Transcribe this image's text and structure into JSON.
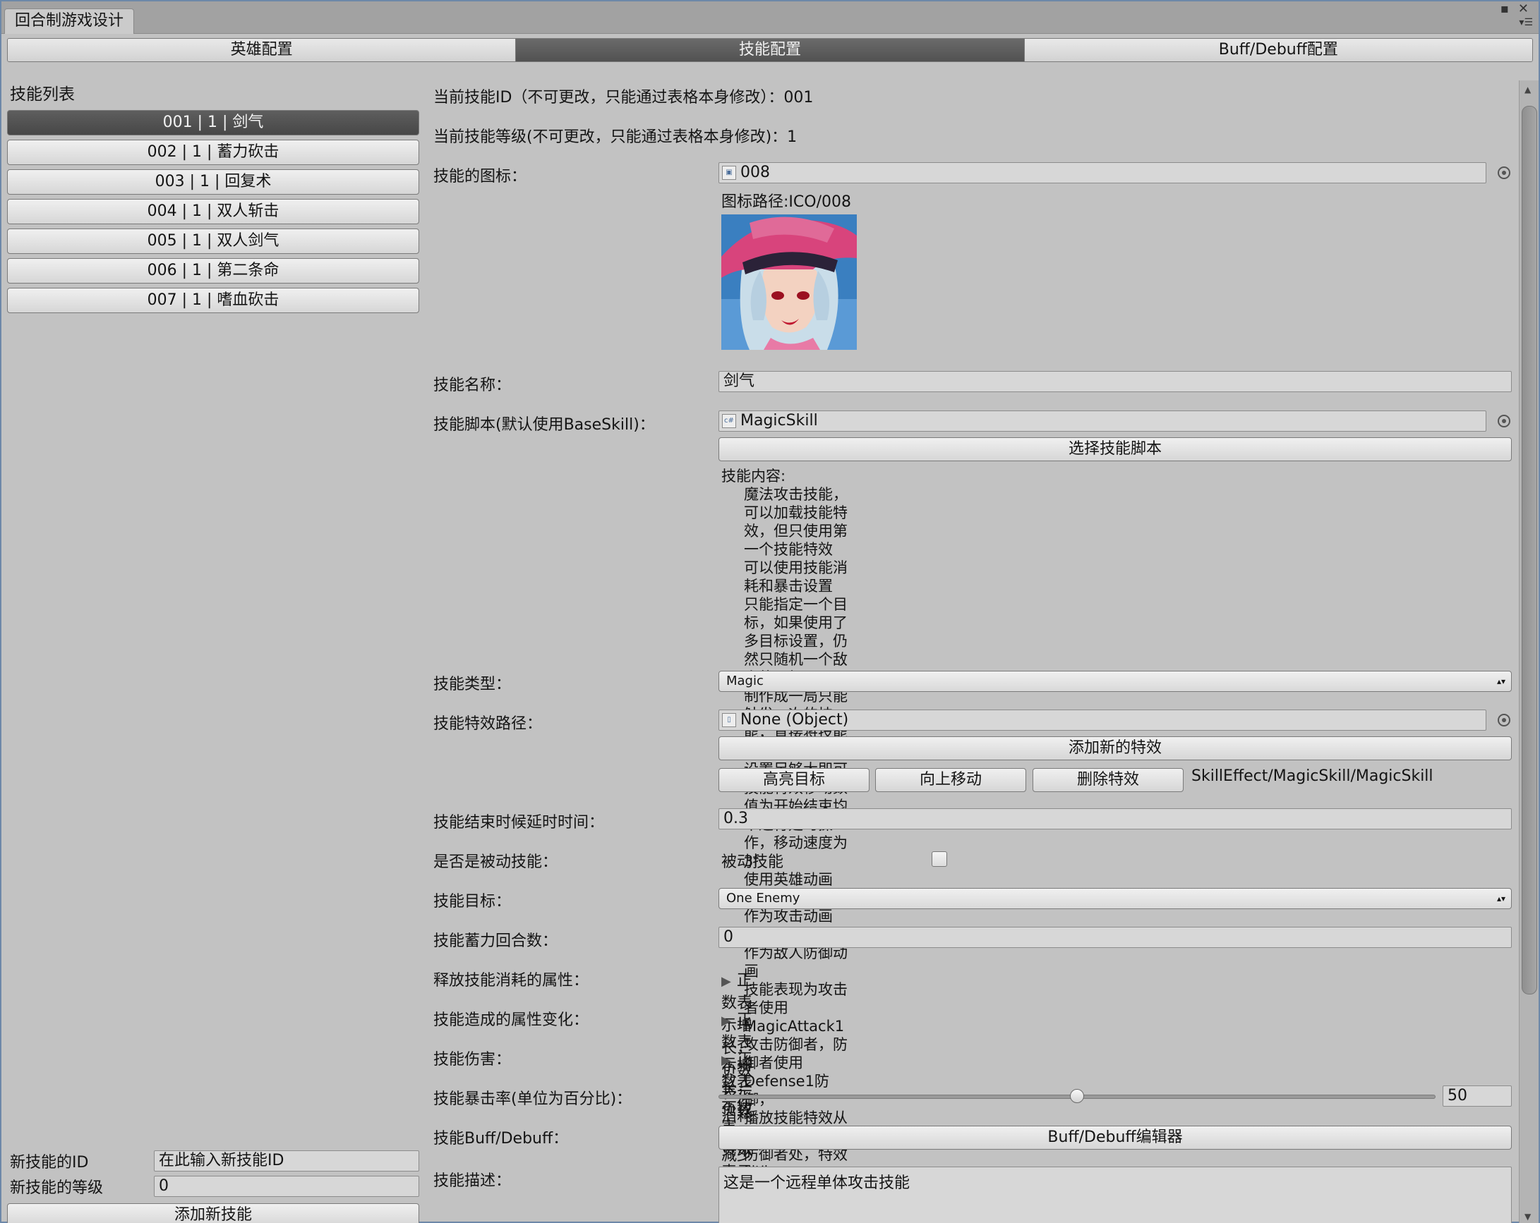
{
  "window": {
    "title": "回合制游戏设计"
  },
  "topbar": {
    "tabs": [
      "英雄配置",
      "技能配置",
      "Buff/Debuff配置"
    ],
    "active": "技能配置"
  },
  "sidebar": {
    "title": "技能列表",
    "items": [
      "001 | 1 | 剑气",
      "002 | 1 | 蓄力砍击",
      "003 | 1 | 回复术",
      "004 | 1 | 双人斩击",
      "005 | 1 | 双人剑气",
      "006 | 1 | 第二条命",
      "007 | 1 | 嗜血砍击"
    ],
    "new_skill": {
      "id_label": "新技能的ID",
      "id_placeholder": "在此输入新技能ID",
      "level_label": "新技能的等级",
      "level_value": "0",
      "add_button": "添加新技能"
    }
  },
  "detail": {
    "id_line": "当前技能ID（不可更改，只能通过表格本身修改）：001",
    "level_line": "当前技能等级(不可更改，只能通过表格本身修改)：1",
    "icon_label": "技能的图标：",
    "icon_value": "008",
    "icon_path": "图标路径:ICO/008",
    "name_label": "技能名称：",
    "name_value": "剑气",
    "script_label": "技能脚本(默认使用BaseSkill)：",
    "script_value": "MagicSkill",
    "select_script_button": "选择技能脚本",
    "content_title": "技能内容:",
    "content_lines": [
      "魔法攻击技能，可以加载技能特效，但只使用第一个技能特效",
      "可以使用技能消耗和暴击设置",
      "只能指定一个目标，如果使用了多目标设置，仍然只随机一个敌人的目标",
      "制作成一局只能触发一次的技能，直接将技能释放消耗回合数设置足够大即可",
      "技能特效移动数值为开始结束均不进行延时操作，移动速度为3f",
      "使用英雄动画 MagicAttack1 作为攻击动画 MagicDefense1 作为敌人防御动画",
      "技能表现为攻击者使用MagicAttack1攻击防御者，防御者使用Defense1防御，",
      "播放技能特效从攻击者处移动到防御者处，特效消失"
    ],
    "type_label": "技能类型：",
    "type_value": "Magic",
    "effect_label": "技能特效路径：",
    "effect_value": "None (Object)",
    "add_effect_button": "添加新的特效",
    "highlight_button": "高亮目标",
    "move_up_button": "向上移动",
    "delete_effect_button": "删除特效",
    "effect_path_text": "SkillEffect/MagicSkill/MagicSkill",
    "delay_label": "技能结束时候延时时间：",
    "delay_value": "0.3",
    "passive_label": "是否是被动技能：",
    "passive_checkbox_label": "被动技能",
    "passive_checked": false,
    "target_label": "技能目标：",
    "target_value": "One Enemy",
    "charge_label": "技能蓄力回合数：",
    "charge_value": "0",
    "cost_label": "释放技能消耗的属性：",
    "cost_foldout": "正数表示增长，负数表示消耗",
    "change_label": "技能造成的属性变化：",
    "change_foldout": "正数表示增长，负数表示减少",
    "damage_label": "技能伤害：",
    "damage_foldout": "正数表示伤害，负数表示增长",
    "crit_label": "技能暴击率(单位为百分比)：",
    "crit_value": "50",
    "crit_fraction": 0.5,
    "buff_label": "技能Buff/Debuff：",
    "buff_button": "Buff/Debuff编辑器",
    "desc_label": "技能描述：",
    "desc_value": "这是一个远程单体攻击技能"
  },
  "icons": {
    "close": "close-icon",
    "maximize": "maximize-icon",
    "menu": "menu-icon",
    "picker": "object-picker-icon",
    "dropdown": "dropdown-arrows-icon"
  },
  "colors": {
    "background": "#c2c2c2",
    "active_tab": "#5a5a5a",
    "window_border": "#6d88a8"
  }
}
